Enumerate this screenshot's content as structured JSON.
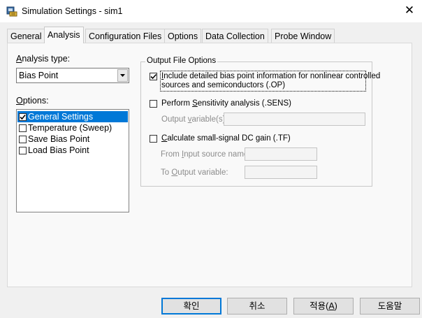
{
  "window": {
    "title": "Simulation Settings - sim1",
    "close_glyph": "✕"
  },
  "tabs": [
    {
      "label": "General"
    },
    {
      "label": "Analysis"
    },
    {
      "label": "Configuration Files"
    },
    {
      "label": "Options"
    },
    {
      "label": "Data Collection"
    },
    {
      "label": "Probe Window"
    }
  ],
  "analysis": {
    "type_label_pre": "",
    "type_label_ul": "A",
    "type_label_post": "nalysis type:",
    "type_value": "Bias Point",
    "options_label_pre": "",
    "options_label_ul": "O",
    "options_label_post": "ptions:",
    "options_items": [
      {
        "label": "General Settings",
        "checked": true,
        "selected": true
      },
      {
        "label": "Temperature (Sweep)",
        "checked": false,
        "selected": false
      },
      {
        "label": "Save Bias Point",
        "checked": false,
        "selected": false
      },
      {
        "label": "Load Bias Point",
        "checked": false,
        "selected": false
      }
    ]
  },
  "output": {
    "group_title": "Output File Options",
    "detailed": {
      "checked": true,
      "line1_ul": "I",
      "line1_rest": "nclude detailed bias point information for nonlinear controlled",
      "line2": "sources and semiconductors (.OP)"
    },
    "sensitivity": {
      "checked": false,
      "pre": "Perform ",
      "ul": "S",
      "post": "ensitivity analysis (.SENS)",
      "var_pre": "Output ",
      "var_ul": "v",
      "var_post": "ariable(s):",
      "var_value": ""
    },
    "dcgain": {
      "checked": false,
      "pre": "",
      "ul": "C",
      "post": "alculate small-signal DC gain (.TF)",
      "from_pre": "From ",
      "from_ul": "I",
      "from_post": "nput source name:",
      "from_value": "",
      "to_pre": "To ",
      "to_ul": "O",
      "to_post": "utput variable:",
      "to_value": ""
    }
  },
  "buttons": {
    "ok": "확인",
    "cancel": "취소",
    "apply_pre": "적용(",
    "apply_ul": "A",
    "apply_post": ")",
    "help": "도움말"
  }
}
